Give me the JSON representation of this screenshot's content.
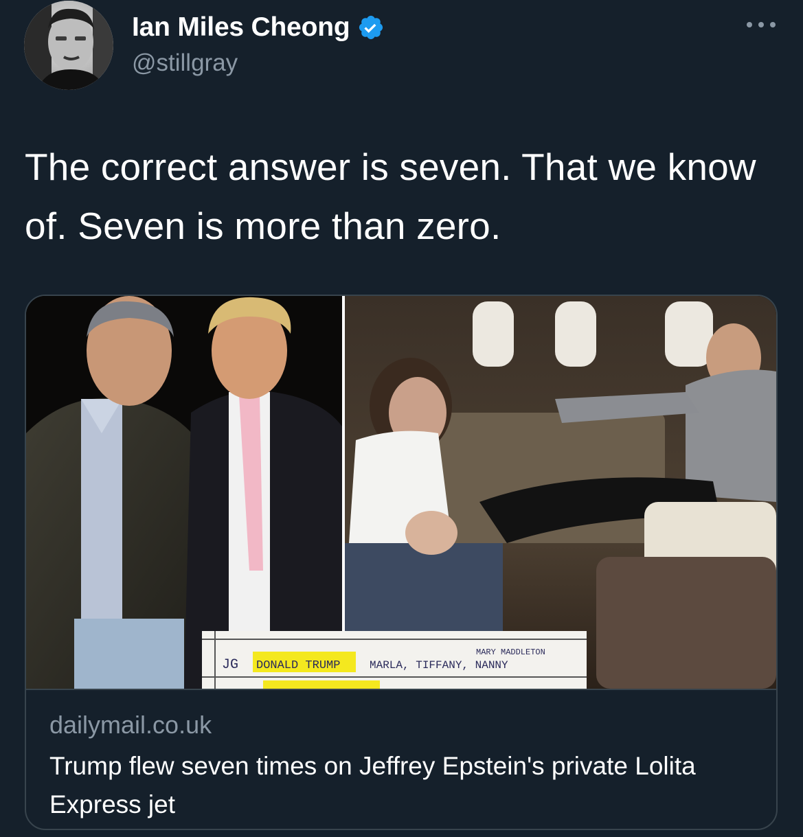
{
  "author": {
    "display_name": "Ian Miles Cheong",
    "handle": "@stillgray",
    "verified": true
  },
  "tweet": {
    "text": "The correct answer is seven. That we know of. Seven is more than zero."
  },
  "link_card": {
    "domain": "dailymail.co.uk",
    "title": "Trump flew seven times on Jeffrey Epstein's private Lolita Express jet",
    "image_note_text": {
      "line1_prefix": "JG",
      "highlighted": "DONALD TRUMP",
      "rest": "MARLA, TIFFANY, NANNY",
      "above": "MARY MADDLETON"
    }
  },
  "colors": {
    "background": "#15202b",
    "text_primary": "#ffffff",
    "text_secondary": "#8b98a5",
    "border": "#38444d",
    "verified_blue": "#1d9bf0",
    "highlight_yellow": "#f4e81f"
  },
  "icons": {
    "verified": "verified-badge-icon",
    "more": "more-options-icon"
  }
}
